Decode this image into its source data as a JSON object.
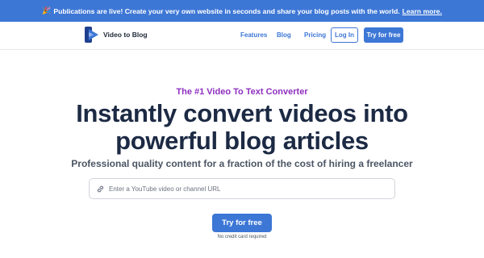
{
  "announcement": {
    "icon": "party-popper-icon",
    "text": "Publications are live! Create your very own website in seconds and share your blog posts with the world.",
    "link": "Learn more."
  },
  "nav": {
    "brand": "Video to Blog",
    "links": [
      "Features",
      "Blog",
      "Pricing"
    ],
    "login": "Log In",
    "try": "Try for free"
  },
  "hero": {
    "eyebrow": "The #1 Video To Text Converter",
    "headline_line1": "Instantly convert videos into",
    "headline_line2": "powerful blog articles",
    "subhead": "Professional quality content for a fraction of the cost of hiring a freelancer",
    "search_placeholder": "Enter a YouTube video or channel URL",
    "search_icon": "link-icon",
    "cta": "Try for free",
    "note": "No credit card required"
  },
  "colors": {
    "accent": "#3d77d6",
    "eyebrow": "#8e2fbf",
    "headline": "#1c2a44"
  }
}
